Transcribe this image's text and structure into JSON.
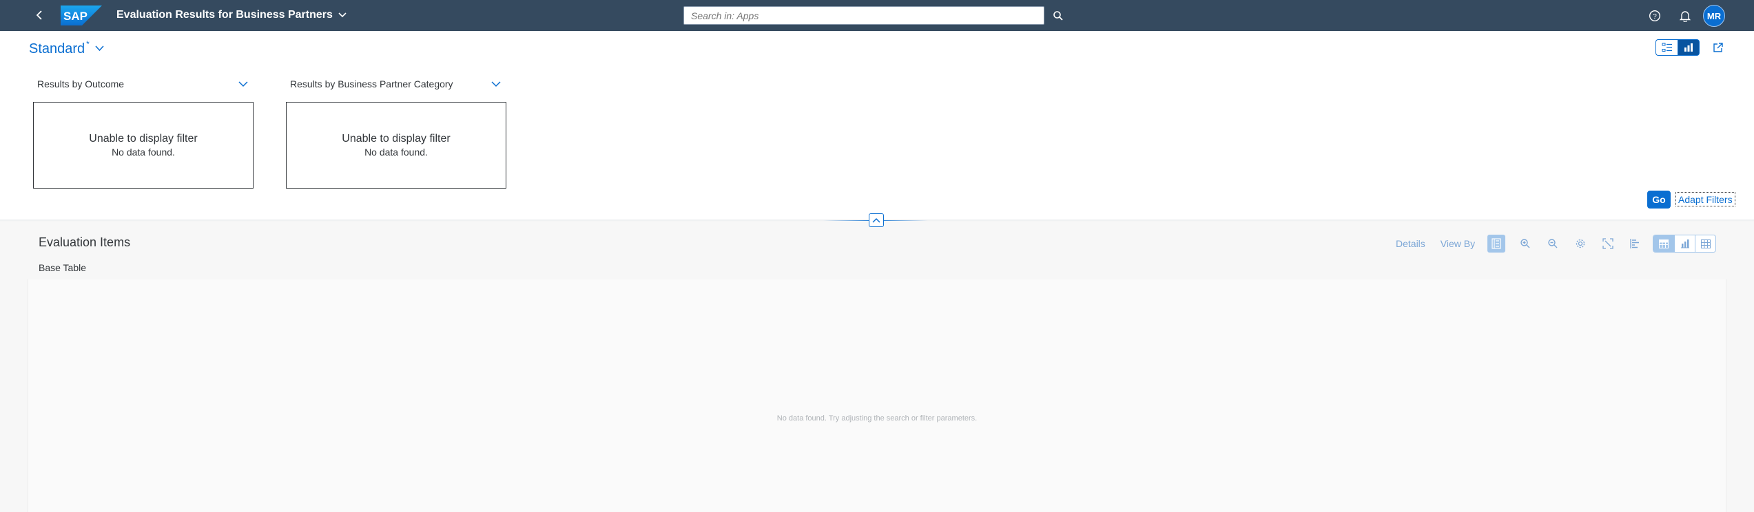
{
  "shell": {
    "brand": "SAP",
    "app_title": "Evaluation Results for Business Partners",
    "search_placeholder": "Search in: Apps",
    "user_initials": "MR"
  },
  "header": {
    "variant_name": "Standard",
    "variant_modified_marker": "*"
  },
  "filters": [
    {
      "title": "Results by Outcome",
      "message": "Unable to display filter",
      "detail": "No data found."
    },
    {
      "title": "Results by Business Partner Category",
      "message": "Unable to display filter",
      "detail": "No data found."
    }
  ],
  "filter_bar": {
    "go_label": "Go",
    "adapt_label": "Adapt Filters"
  },
  "section": {
    "title": "Evaluation Items",
    "subtitle": "Base Table",
    "toolbar": {
      "details_label": "Details",
      "view_by_label": "View By"
    },
    "no_data_text": "No data found. Try adjusting the search or filter parameters."
  },
  "colors": {
    "shell": "#354a5f",
    "accent": "#0a6ed1",
    "disabled_accent": "#a3c6ea",
    "section_bg": "#f7f7f7"
  }
}
